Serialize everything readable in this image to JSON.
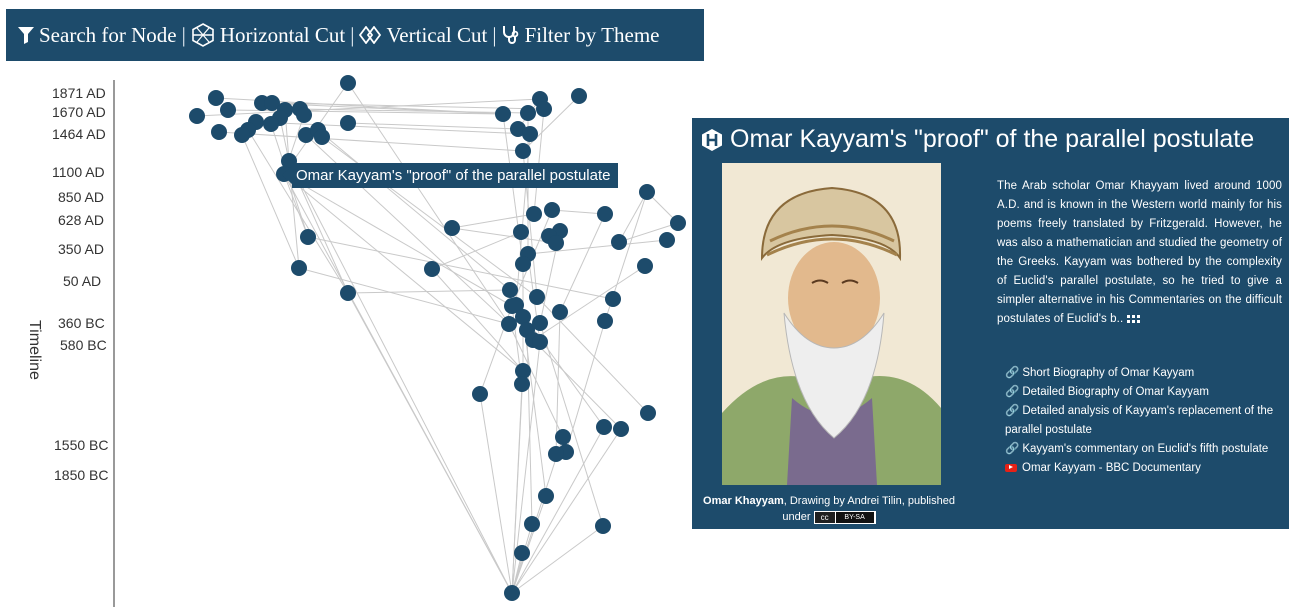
{
  "toolbar": {
    "search": "Search for Node",
    "horizontal": "Horizontal Cut",
    "vertical": "Vertical Cut",
    "filter": "Filter by Theme",
    "separator": "|"
  },
  "timeline": {
    "title": "Timeline",
    "ticks": [
      "1871 AD",
      "1670 AD",
      "1464 AD",
      "1100 AD",
      "850 AD",
      "628 AD",
      "350 AD",
      "50 AD",
      "360 BC",
      "580 BC",
      "1550 BC",
      "1850 BC"
    ]
  },
  "tooltip": "Omar Kayyam's \"proof\" of the parallel postulate",
  "panel": {
    "title": "Omar Kayyam's \"proof\" of the parallel postulate",
    "description": "The Arab scholar Omar Khayyam lived around 1000 A.D. and is known in the Western world mainly for his poems freely translated by Fritzgerald. However, he was also a mathematician and studied the geometry of the Greeks. Kayyam was bothered by the complexity of Euclid's parallel postulate, so he tried to give a simpler alternative in his Commentaries on the difficult postulates of Euclid's b..",
    "more_icon": "ellipsis-icon",
    "caption_name": "Omar Khayyam",
    "caption_text": ", Drawing by Andrei Tilin, published under",
    "license": {
      "cc": "cc",
      "by": "BY-SA"
    },
    "links": [
      {
        "icon": "link-icon",
        "label": "Short Biography of Omar Kayyam"
      },
      {
        "icon": "link-icon",
        "label": "Detailed Biography of Omar Kayyam"
      },
      {
        "icon": "link-icon",
        "label": "Detailed analysis of Kayyam's replacement of the parallel postulate"
      },
      {
        "icon": "link-icon",
        "label": "Kayyam's commentary on Euclid's fifth postulate"
      },
      {
        "icon": "youtube-icon",
        "label": "Omar Kayyam - BBC Documentary"
      }
    ]
  },
  "colors": {
    "node": "#1d4b6b",
    "edge": "#c9c9c9",
    "panel": "#1d4b6b"
  }
}
